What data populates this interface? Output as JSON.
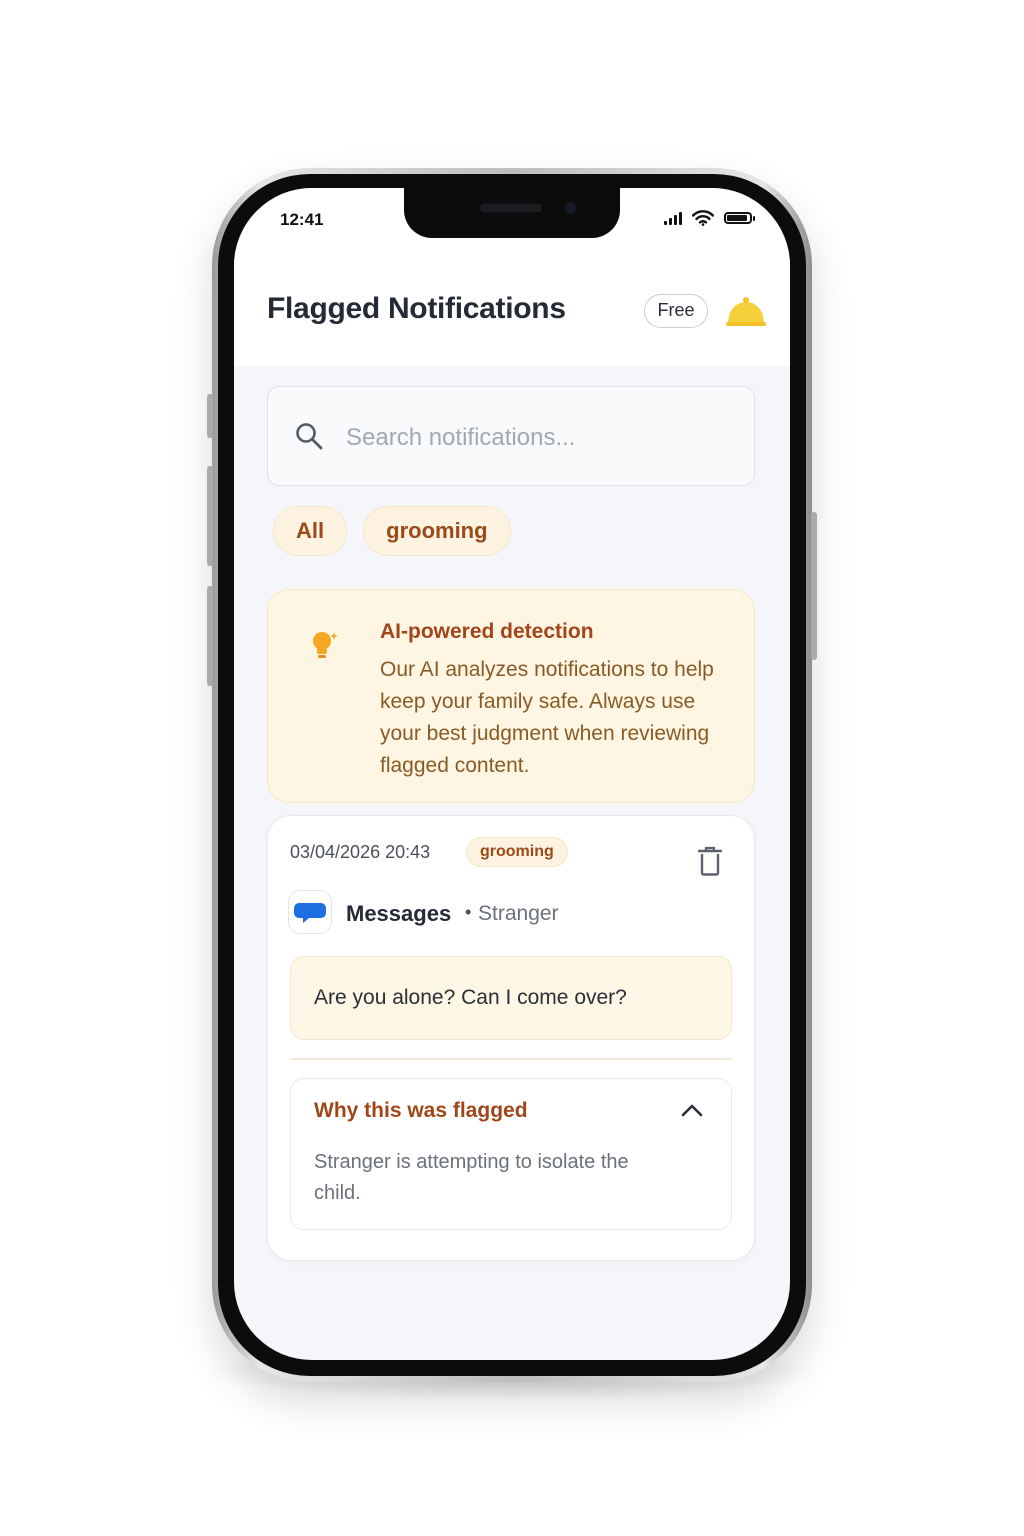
{
  "status_bar": {
    "time": "12:41"
  },
  "header": {
    "title": "Flagged Notifications",
    "plan_badge": "Free"
  },
  "search": {
    "placeholder": "Search notifications..."
  },
  "filters": {
    "chips": [
      "All",
      "grooming"
    ]
  },
  "ai_info": {
    "title": "AI-powered detection",
    "body": "Our AI analyzes notifications to help keep your family safe. Always use your best judgment when reviewing flagged content."
  },
  "notification": {
    "timestamp": "03/04/2026 20:43",
    "tag": "grooming",
    "app_name": "Messages",
    "separator": "•",
    "sender": "Stranger",
    "message": "Are you alone? Can I come over?",
    "why_title": "Why this was flagged",
    "why_body": "Stranger is attempting to isolate the child.",
    "why_expanded": true
  },
  "icons": {
    "search": "search-icon",
    "bell": "bell-icon",
    "bulb": "lightbulb-icon",
    "trash": "trash-icon",
    "app": "messages-app-icon",
    "chevron": "chevron-up-icon"
  },
  "colors": {
    "accent": "#a2461a",
    "card_warm": "#fef6e3",
    "bell": "#f6cf3c",
    "bulb": "#f5a623",
    "messages_blue": "#1f6fe0"
  }
}
